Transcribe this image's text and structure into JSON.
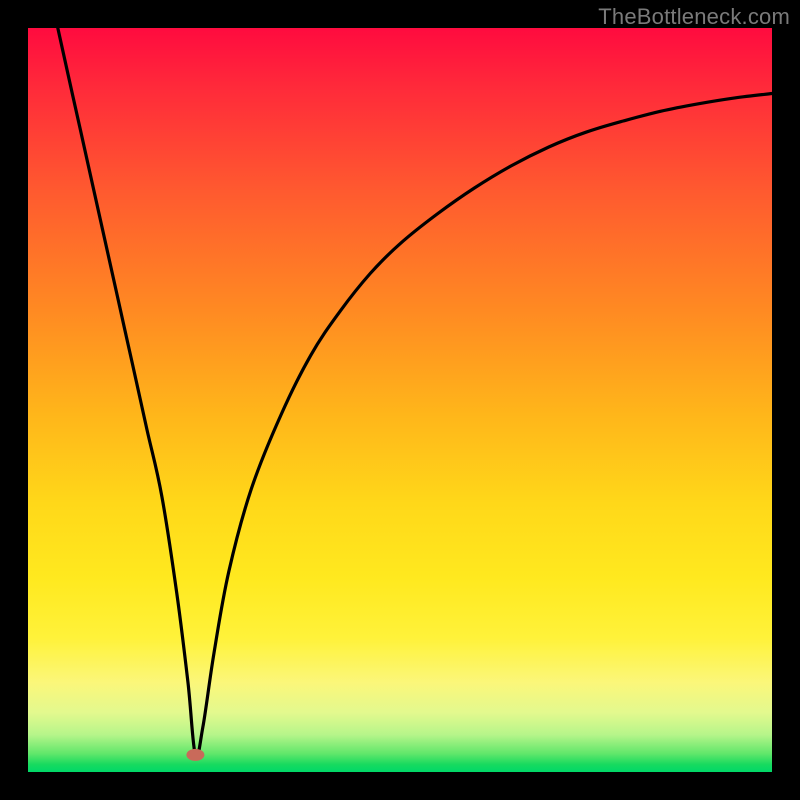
{
  "watermark": "TheBottleneck.com",
  "colors": {
    "frame": "#000000",
    "curve": "#000000",
    "marker": "#c96a5a",
    "gradient_top": "#ff0b3f",
    "gradient_bottom": "#00d868"
  },
  "chart_data": {
    "type": "line",
    "title": "",
    "xlabel": "",
    "ylabel": "",
    "xlim": [
      0,
      100
    ],
    "ylim": [
      0,
      100
    ],
    "grid": false,
    "legend": false,
    "note": "No numeric axis ticks are visible; values are read from geometry in percent of plot width/height. y=100 is top, y=0 is bottom.",
    "series": [
      {
        "name": "curve",
        "x": [
          4,
          6,
          8,
          10,
          12,
          14,
          16,
          18,
          20,
          21.5,
          22.5,
          23.5,
          25,
          27,
          30,
          34,
          38,
          42,
          46,
          50,
          55,
          60,
          65,
          70,
          75,
          80,
          85,
          90,
          95,
          100
        ],
        "y": [
          100,
          91,
          82,
          73,
          64,
          55,
          46,
          37,
          24,
          12,
          2.3,
          6,
          16,
          27,
          38,
          48,
          56,
          62,
          67,
          71,
          75,
          78.5,
          81.5,
          84,
          86,
          87.5,
          88.8,
          89.8,
          90.6,
          91.2
        ]
      }
    ],
    "marker": {
      "x": 22.5,
      "y": 2.3,
      "shape": "ellipse"
    },
    "background_gradient": {
      "orientation": "vertical",
      "stops": [
        {
          "pos": 0.0,
          "color": "#ff0b3f"
        },
        {
          "pos": 0.5,
          "color": "#ffb61a"
        },
        {
          "pos": 0.82,
          "color": "#fff23a"
        },
        {
          "pos": 1.0,
          "color": "#00d868"
        }
      ]
    }
  }
}
